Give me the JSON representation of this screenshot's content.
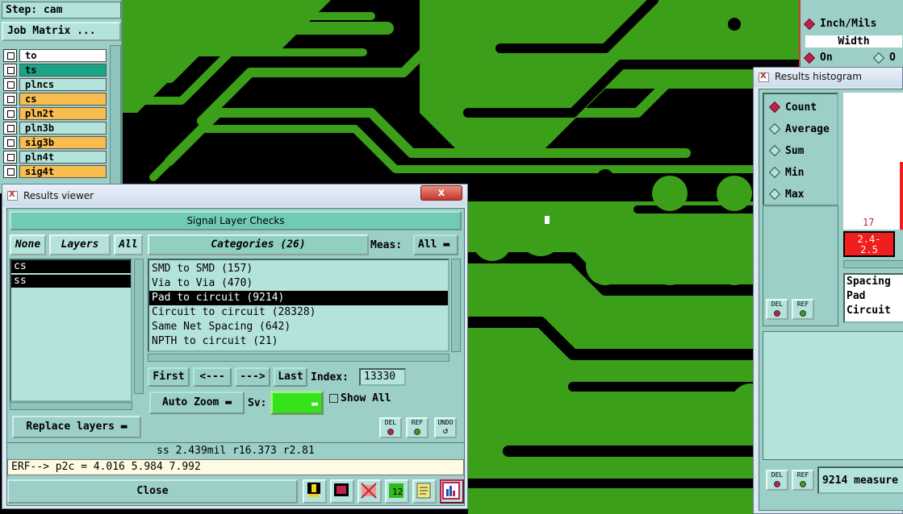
{
  "left_panel": {
    "step_label": "Step: cam",
    "job_matrix_label": "Job Matrix ...",
    "layers": [
      {
        "name": "to",
        "color": "#ffffff"
      },
      {
        "name": "ts",
        "color": "#1aa488"
      },
      {
        "name": "plncs",
        "color": "#b4e3dc"
      },
      {
        "name": "cs",
        "color": "#f9bd4f"
      },
      {
        "name": "pln2t",
        "color": "#f9bd4f"
      },
      {
        "name": "pln3b",
        "color": "#b4e3dc"
      },
      {
        "name": "sig3b",
        "color": "#f9bd4f"
      },
      {
        "name": "pln4t",
        "color": "#b4e3dc"
      },
      {
        "name": "sig4t",
        "color": "#f9bd4f"
      }
    ]
  },
  "viewer": {
    "title": "Results viewer",
    "close_x": "x",
    "heading": "Signal Layer Checks",
    "none_label": "None",
    "layers_label": "Layers",
    "all_label": "All",
    "categories_label": "Categories (26)",
    "meas_label": "Meas:",
    "meas_value": "All",
    "layer_items": [
      "cs",
      "ss"
    ],
    "categories": [
      "SMD to SMD (157)",
      "Via to Via (470)",
      "Pad to circuit (9214)",
      "Circuit to circuit (28328)",
      "Same Net Spacing (642)",
      "NPTH to circuit (21)"
    ],
    "selected_category": 2,
    "first_label": "First",
    "prev_label": "<---",
    "next_label": "--->",
    "last_label": "Last",
    "index_label": "Index:",
    "index_value": "13330",
    "autozoom_label": "Auto Zoom",
    "sv_label": "Sv:",
    "show_all_label": "Show All",
    "replace_layers_label": "Replace layers",
    "del_label": "DEL",
    "ref_label": "REF",
    "undo_label": "UNDO",
    "status_line": "ss 2.439mil   r16.373   r2.81",
    "erf_line": "ERF--> p2c = 4.016 5.984 7.992",
    "close_label": "Close"
  },
  "histogram": {
    "title": "Results histogram",
    "options": [
      "Count",
      "Average",
      "Sum",
      "Min",
      "Max"
    ],
    "selected_option": 0,
    "bar_count": "17",
    "bar_range": "2.4-\n2.5",
    "list_items": [
      "Spacing",
      "Pad",
      "Circuit"
    ],
    "del_label": "DEL",
    "ref_label": "REF",
    "measure_text": "9214 measure"
  },
  "topright": {
    "units_label": "Inch/Mils",
    "width_label": "Width",
    "on_label": "On",
    "other_label": "O"
  },
  "colors": {
    "panel": "#9ccfc8",
    "copper": "#3b9f1a",
    "accent": "#c2204a"
  }
}
